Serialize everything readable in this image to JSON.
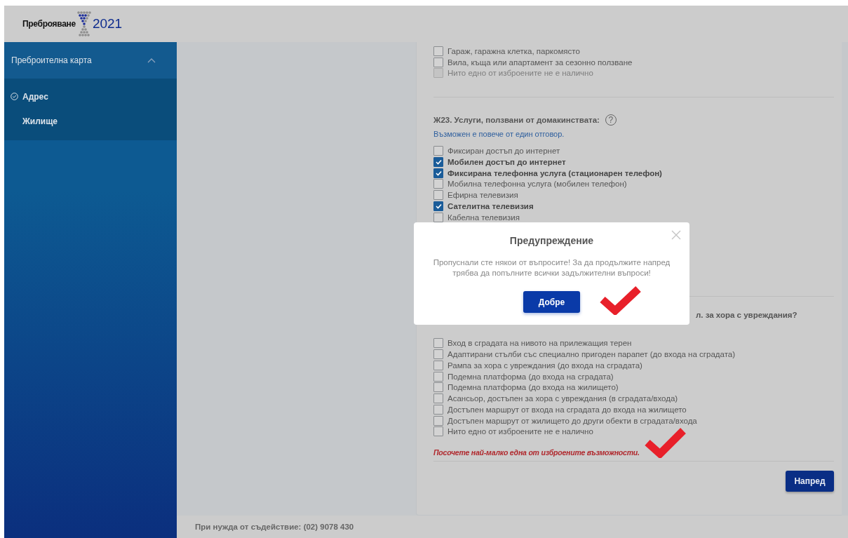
{
  "header": {
    "logo_text": "Преброяване",
    "logo_year": "2021"
  },
  "sidebar": {
    "sections": [
      {
        "label": "Преброителна карта",
        "expanded": true,
        "items": [
          {
            "label": "Адрес",
            "completed": true
          },
          {
            "label": "Жилище",
            "completed": false
          }
        ]
      }
    ]
  },
  "form": {
    "groups": [
      {
        "options": [
          {
            "label": "Гараж, гаражна клетка, паркомясто",
            "checked": false,
            "disabled": false
          },
          {
            "label": "Вила, къща или апартамент за сезонно ползване",
            "checked": false,
            "disabled": false
          },
          {
            "label": "Нито едно от изброените не е налично",
            "checked": false,
            "disabled": true
          }
        ]
      },
      {
        "question": "Ж23. Услуги, ползвани от домакинствата:",
        "help_icon": "?",
        "hint": "Възможен е повече от един отговор.",
        "options": [
          {
            "label": "Фиксиран достъп до интернет",
            "checked": false,
            "disabled": false
          },
          {
            "label": "Мобилен достъп до интернет",
            "checked": true,
            "disabled": false
          },
          {
            "label": "Фиксирана телефонна услуга (стационарен телефон)",
            "checked": true,
            "disabled": false
          },
          {
            "label": "Мобилна телефонна услуга (мобилен телефон)",
            "checked": false,
            "disabled": false
          },
          {
            "label": "Ефирна телевизия",
            "checked": false,
            "disabled": false
          },
          {
            "label": "Сателитна телевизия",
            "checked": true,
            "disabled": false
          },
          {
            "label": "Кабелна телевизия",
            "checked": false,
            "disabled": false
          }
        ]
      },
      {
        "question": "л. за хора с увреждания?",
        "options": [
          {
            "label": "Вход в сградата на нивото на прилежащия терен",
            "checked": false,
            "disabled": false
          },
          {
            "label": "Адаптирани стълби със специално пригоден парапет (до входа на сградата)",
            "checked": false,
            "disabled": false
          },
          {
            "label": "Рампа за хора с увреждания (до входа на сградата)",
            "checked": false,
            "disabled": false
          },
          {
            "label": "Подемна платформа (до входа на сградата)",
            "checked": false,
            "disabled": false
          },
          {
            "label": "Подемна платформа (до входа на жилището)",
            "checked": false,
            "disabled": false
          },
          {
            "label": "Асансьор, достъпен за хора с увреждания (в сградата/входа)",
            "checked": false,
            "disabled": false
          },
          {
            "label": "Достъпен маршрут от входа на сградата до входа на жилището",
            "checked": false,
            "disabled": false
          },
          {
            "label": "Достъпен маршрут от жилището до други обекти в сградата/входа",
            "checked": false,
            "disabled": false
          },
          {
            "label": "Нито едно от изброените не е налично",
            "checked": false,
            "disabled": false
          }
        ],
        "error": "Посочете най-малко една от изброените възможности."
      }
    ],
    "next_button": "Напред"
  },
  "dialog": {
    "title": "Предупреждение",
    "message": "Пропуснали сте някои от въпросите! За да продължите напред трябва да попълните всички задължителни въпроси!",
    "ok_button": "Добре"
  },
  "footer": {
    "help_text": "При нужда от съдействие: (02) 9078 430"
  }
}
